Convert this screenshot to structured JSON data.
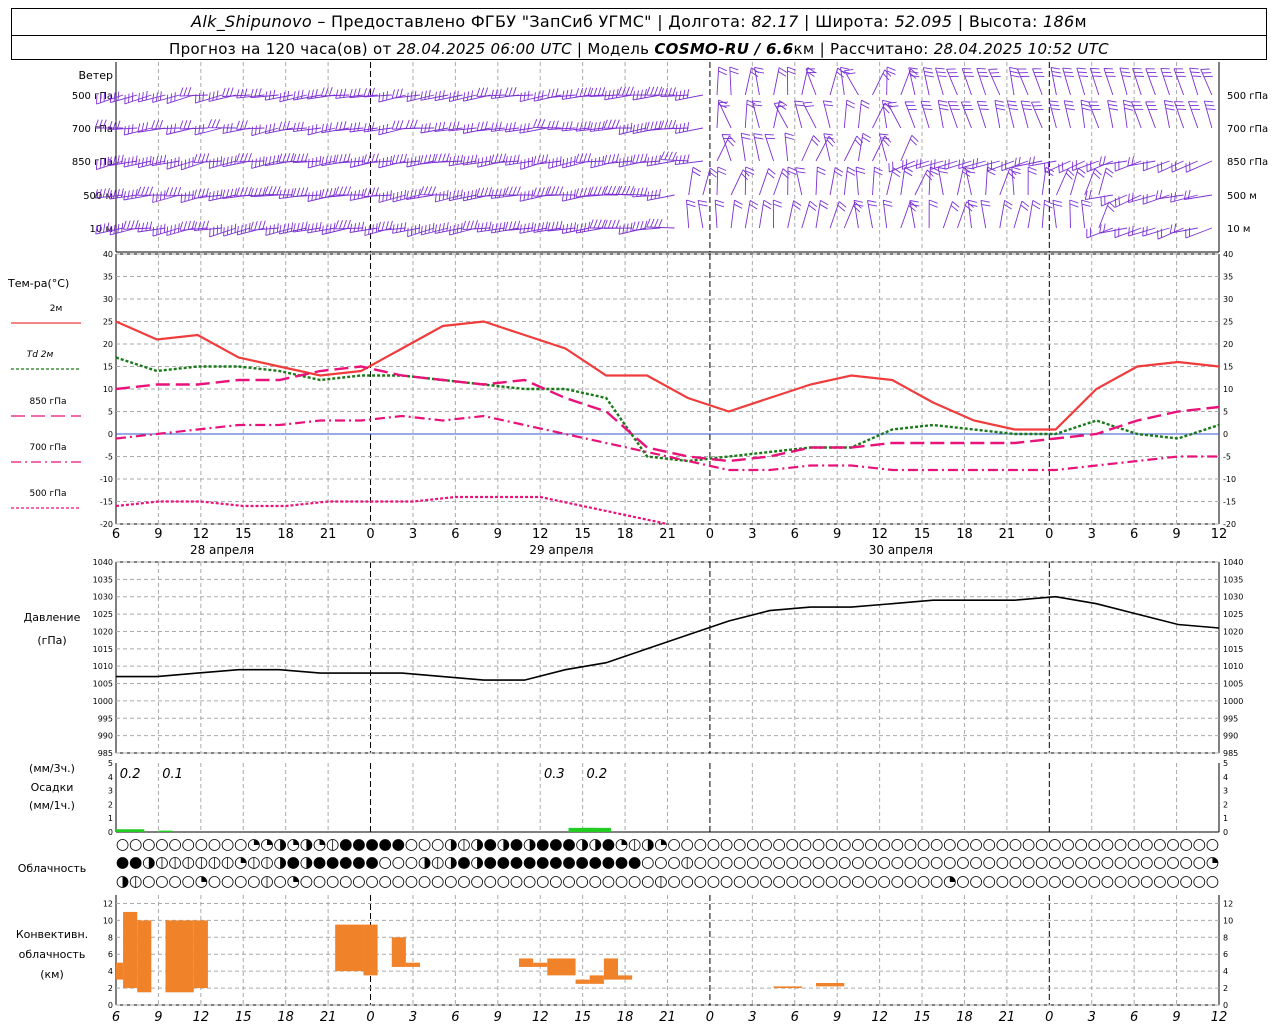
{
  "header": {
    "station": "Alk_Shipunovo",
    "provider": " – Предоставлено ФГБУ \"ЗапСиб УГМС\" | Долгота: ",
    "lon": "82.17",
    "lat_label": " | Широта: ",
    "lat": "52.095",
    "alt_label": " | Высота: ",
    "alt": "186",
    "alt_unit": "м",
    "forecast_label": "Прогноз на 120 часа(ов) от ",
    "forecast_from": "28.04.2025 06:00 UTC",
    "model_label": "  | Модель ",
    "model": "COSMO-RU / 6.6",
    "model_unit": "км",
    "calc_label": " | Рассчитано: ",
    "calc_time": "28.04.2025 10:52 UTC"
  },
  "colors": {
    "wind": "#7b2fd2",
    "t2m": "#f03c3c",
    "td2m": "#1a7a1a",
    "t850": "#e8127a",
    "t700": "#e8127a",
    "t500": "#e8127a",
    "pressure": "#000000",
    "precip": "#22cc22",
    "conv": "#f0822a"
  },
  "wind_panel": {
    "title": "Ветер",
    "levels": [
      "500 гПа",
      "700 гПа",
      "850 гПа",
      "500  м",
      "10  м"
    ]
  },
  "temp_panel": {
    "title": "Тем-ра(°С)",
    "legend": [
      {
        "label": "2м",
        "key": "t2m",
        "dash": ""
      },
      {
        "label": "Td  2м",
        "key": "td2m",
        "dash": "3,2"
      },
      {
        "label": "850 гПа",
        "key": "t850",
        "dash": "14,6"
      },
      {
        "label": "700 гПа",
        "key": "t700",
        "dash": "10,4,2,4"
      },
      {
        "label": "500 гПа",
        "key": "t500",
        "dash": "3,2"
      }
    ]
  },
  "pressure_panel": {
    "title1": "Давление",
    "title2": "(гПа)"
  },
  "precip_panel": {
    "title1": "(мм/3ч.)",
    "title2": "Осадки",
    "title3": "(мм/1ч.)"
  },
  "cloud_panel": {
    "title": "Облачность"
  },
  "conv_panel": {
    "title1": "Конвективн.",
    "title2": "облачность",
    "title3": "(км)"
  },
  "time_axis": {
    "tick_labels": [
      "6",
      "9",
      "12",
      "15",
      "18",
      "21",
      "0",
      "3",
      "6",
      "9",
      "12",
      "15",
      "18",
      "21",
      "0",
      "3",
      "6",
      "9",
      "12",
      "15",
      "18",
      "21",
      "0",
      "3",
      "6",
      "9",
      "12"
    ],
    "dates": [
      "28 апреля",
      "29 апреля",
      "30 апреля"
    ]
  },
  "chart_data": [
    {
      "type": "line",
      "panel": "temperature",
      "xlabel": "",
      "ylabel": "Тем-ра(°С)",
      "ylim": [
        -20,
        40
      ],
      "y_ticks": [
        40,
        35,
        30,
        25,
        20,
        15,
        10,
        5,
        0,
        -5,
        -10,
        -15,
        -20
      ],
      "x_hours": [
        0,
        3,
        6,
        9,
        12,
        15,
        18,
        21,
        24,
        27,
        30,
        33,
        36,
        39,
        42,
        45,
        48,
        51,
        54,
        57,
        60,
        63,
        66,
        69,
        72,
        75,
        78
      ],
      "series": [
        {
          "name": "2м",
          "values": [
            25,
            21,
            22,
            17,
            15,
            13,
            14,
            19,
            24,
            25,
            22,
            19,
            13,
            13,
            8,
            5,
            8,
            11,
            13,
            12,
            7,
            3,
            1,
            1,
            10,
            15,
            16,
            15
          ]
        },
        {
          "name": "Td  2м",
          "values": [
            17,
            14,
            15,
            15,
            14,
            12,
            13,
            13,
            12,
            11,
            10,
            10,
            8,
            -5,
            -6,
            -5,
            -4,
            -3,
            -3,
            1,
            2,
            1,
            0,
            0,
            3,
            0,
            -1,
            2
          ]
        },
        {
          "name": "850 гПа",
          "values": [
            10,
            11,
            11,
            12,
            12,
            14,
            15,
            13,
            12,
            11,
            12,
            8,
            5,
            -3,
            -5,
            -6,
            -5,
            -3,
            -3,
            -2,
            -2,
            -2,
            -2,
            -1,
            0,
            3,
            5,
            6
          ]
        },
        {
          "name": "700 гПа",
          "values": [
            -1,
            0,
            1,
            2,
            2,
            3,
            3,
            4,
            3,
            4,
            2,
            0,
            -2,
            -4,
            -6,
            -8,
            -8,
            -7,
            -7,
            -8,
            -8,
            -8,
            -8,
            -8,
            -7,
            -6,
            -5,
            -5
          ]
        },
        {
          "name": "500 гПа",
          "values": [
            -16,
            -15,
            -15,
            -16,
            -16,
            -15,
            -15,
            -15,
            -14,
            -14,
            -14,
            -16,
            -18,
            -20
          ]
        }
      ]
    },
    {
      "type": "line",
      "panel": "pressure",
      "ylabel": "Давление (гПа)",
      "ylim": [
        985,
        1040
      ],
      "y_ticks": [
        1040,
        1035,
        1030,
        1025,
        1020,
        1015,
        1010,
        1005,
        1000,
        995,
        990,
        985
      ],
      "series": [
        {
          "name": "pressure",
          "values": [
            1007,
            1007,
            1008,
            1009,
            1009,
            1008,
            1008,
            1008,
            1007,
            1006,
            1006,
            1009,
            1011,
            1015,
            1019,
            1023,
            1026,
            1027,
            1027,
            1028,
            1029,
            1029,
            1029,
            1030,
            1028,
            1025,
            1022,
            1021
          ]
        }
      ]
    },
    {
      "type": "bar",
      "panel": "precipitation",
      "ylim": [
        0,
        5
      ],
      "y_ticks": [
        5,
        4,
        3,
        2,
        1,
        0
      ],
      "labels": [
        {
          "hour": 1,
          "text": "0.2"
        },
        {
          "hour": 4,
          "text": "0.1"
        },
        {
          "hour": 31,
          "text": "0.3"
        },
        {
          "hour": 34,
          "text": "0.2"
        }
      ],
      "bars": [
        {
          "start": 0,
          "end": 2,
          "value": 0.2
        },
        {
          "start": 3,
          "end": 4,
          "value": 0.1
        },
        {
          "start": 32,
          "end": 34,
          "value": 0.3
        },
        {
          "start": 33,
          "end": 35,
          "value": 0.3
        }
      ]
    },
    {
      "type": "bar",
      "panel": "convective_cloud",
      "ylabel": "Конвективн. облачность (км)",
      "ylim": [
        0,
        13
      ],
      "y_ticks": [
        12,
        10,
        8,
        6,
        4,
        2,
        0
      ],
      "bars": [
        {
          "start": 0,
          "end": 0.5,
          "bottom": 3,
          "top": 5
        },
        {
          "start": 0.5,
          "end": 1.5,
          "bottom": 2,
          "top": 11
        },
        {
          "start": 1.5,
          "end": 2.5,
          "bottom": 1.5,
          "top": 10
        },
        {
          "start": 3.5,
          "end": 5.5,
          "bottom": 1.5,
          "top": 10
        },
        {
          "start": 5.5,
          "end": 6.5,
          "bottom": 2,
          "top": 10
        },
        {
          "start": 15.5,
          "end": 17.5,
          "bottom": 4,
          "top": 9.5
        },
        {
          "start": 17.5,
          "end": 18.5,
          "bottom": 3.5,
          "top": 9.5
        },
        {
          "start": 19.5,
          "end": 20.5,
          "bottom": 4.5,
          "top": 8
        },
        {
          "start": 20.5,
          "end": 21.5,
          "bottom": 4.5,
          "top": 5
        },
        {
          "start": 28.5,
          "end": 29.5,
          "bottom": 4.5,
          "top": 5.5
        },
        {
          "start": 29.5,
          "end": 30.5,
          "bottom": 4.5,
          "top": 5
        },
        {
          "start": 30.5,
          "end": 32.5,
          "bottom": 3.5,
          "top": 5.5
        },
        {
          "start": 32.5,
          "end": 33.5,
          "bottom": 2.5,
          "top": 3
        },
        {
          "start": 33.5,
          "end": 34.5,
          "bottom": 2.5,
          "top": 3.5
        },
        {
          "start": 34.5,
          "end": 35.5,
          "bottom": 3,
          "top": 5.5
        },
        {
          "start": 35.5,
          "end": 36.5,
          "bottom": 3,
          "top": 3.5
        },
        {
          "start": 46.5,
          "end": 48.5,
          "bottom": 2,
          "top": 2.2
        },
        {
          "start": 49.5,
          "end": 51.5,
          "bottom": 2.2,
          "top": 2.6
        }
      ]
    }
  ],
  "cloud_rows": [
    "ooooooooooqqhqhqdfffffooohdhfhfhfffhhfqdhqoooooooooooooooooooooooooooooooooooooooooo",
    "ffhddddddqddhfhfffffooohdhfhffffffffffffooodoooooooooooooooooooooooooooooooooooooooq",
    "hdooooqoooodoqooooooooooooooooooooooooooodoooooooooooooooooooooqoooooooooooooooooooo"
  ]
}
